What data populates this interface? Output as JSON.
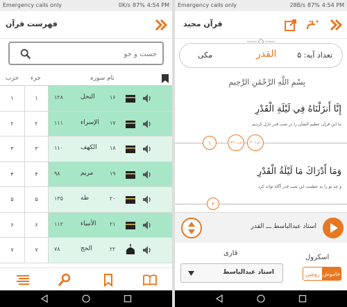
{
  "colors": {
    "accent": "#e87722",
    "green": "#a8e6c8",
    "green_dark": "#7fd4ab",
    "row_light": "#fff",
    "text": "#333"
  },
  "left": {
    "status": {
      "left": "Emergency calls only",
      "mid": "0K/s",
      "battery": "87%",
      "time": "4:54 PM"
    },
    "title": "فهرست قرآن",
    "back_icon": "double-chevron-right-icon",
    "search": {
      "placeholder": "جست و جو",
      "value": ""
    },
    "table_headers": {
      "hezb": "حزب",
      "jozv": "جزء",
      "surah_name": "نام سوره"
    },
    "rows": [
      {
        "hezb": "۱",
        "jozv": "۱",
        "name": "النحل",
        "num": "۱۶",
        "ayat": "۱۲۸",
        "type": "meccan",
        "highlight": true
      },
      {
        "hezb": "۲",
        "jozv": "۲",
        "name": "الإسراء",
        "num": "۱۷",
        "ayat": "۱۱۱",
        "type": "meccan",
        "highlight": true
      },
      {
        "hezb": "۳",
        "jozv": "۳",
        "name": "الكهف",
        "num": "۱۸",
        "ayat": "۱۱۰",
        "type": "meccan",
        "highlight": false
      },
      {
        "hezb": "۴",
        "jozv": "۴",
        "name": "مريم",
        "num": "۱۹",
        "ayat": "۹۸",
        "type": "meccan",
        "highlight": true
      },
      {
        "hezb": "۵",
        "jozv": "۵",
        "name": "طه",
        "num": "۲۰",
        "ayat": "۱۳۵",
        "type": "meccan",
        "highlight": false
      },
      {
        "hezb": "۶",
        "jozv": "۶",
        "name": "الأنبياء",
        "num": "۲۱",
        "ayat": "۱۱۲",
        "type": "meccan",
        "highlight": true
      },
      {
        "hezb": "۷",
        "jozv": "۷",
        "name": "الحج",
        "num": "۲۲",
        "ayat": "۷۸",
        "type": "medinan",
        "highlight": false
      }
    ],
    "bottom_nav": [
      "list-icon",
      "search-icon",
      "bookmark-icon",
      "book-icon"
    ]
  },
  "right": {
    "status": {
      "left": "Emergency calls only",
      "mid": "28B/s",
      "battery": "87%",
      "time": "4:54 PM"
    },
    "title": "قرآن مجید",
    "surah": {
      "ayah_count_label": "تعداد آیه: ۵",
      "name": "القدر",
      "place": "مکی"
    },
    "bismillah": "بِسْمِ اللَّهِ الرَّحْمَٰنِ الرَّحِيمِ",
    "ayat": [
      {
        "ar": "إِنَّا أَنزَلْنَاهُ فِي لَيْلَةِ الْقَدْرِ",
        "fa": "ما این قرآن عظیم الشأن را در شب قدر نازل کردیم",
        "num": "۱",
        "badge1": "جزء ۳۰",
        "badge2": "حزب ۱۲۹"
      },
      {
        "ar": "وَمَا أَدْرَاكَ مَا لَيْلَةُ الْقَدْرِ",
        "fa": "و چه تو را به عظمت این شب قدر آگاه تواند کرد",
        "num": "۲"
      }
    ],
    "player": {
      "reciter_label": "استاد عبدالباسط ـــ القدر"
    },
    "settings": {
      "reciter_title": "قاری",
      "reciter_value": "استاد عبدالباسط",
      "scroll_title": "اسکرول",
      "on": "روشن",
      "off": "خاموش"
    }
  }
}
